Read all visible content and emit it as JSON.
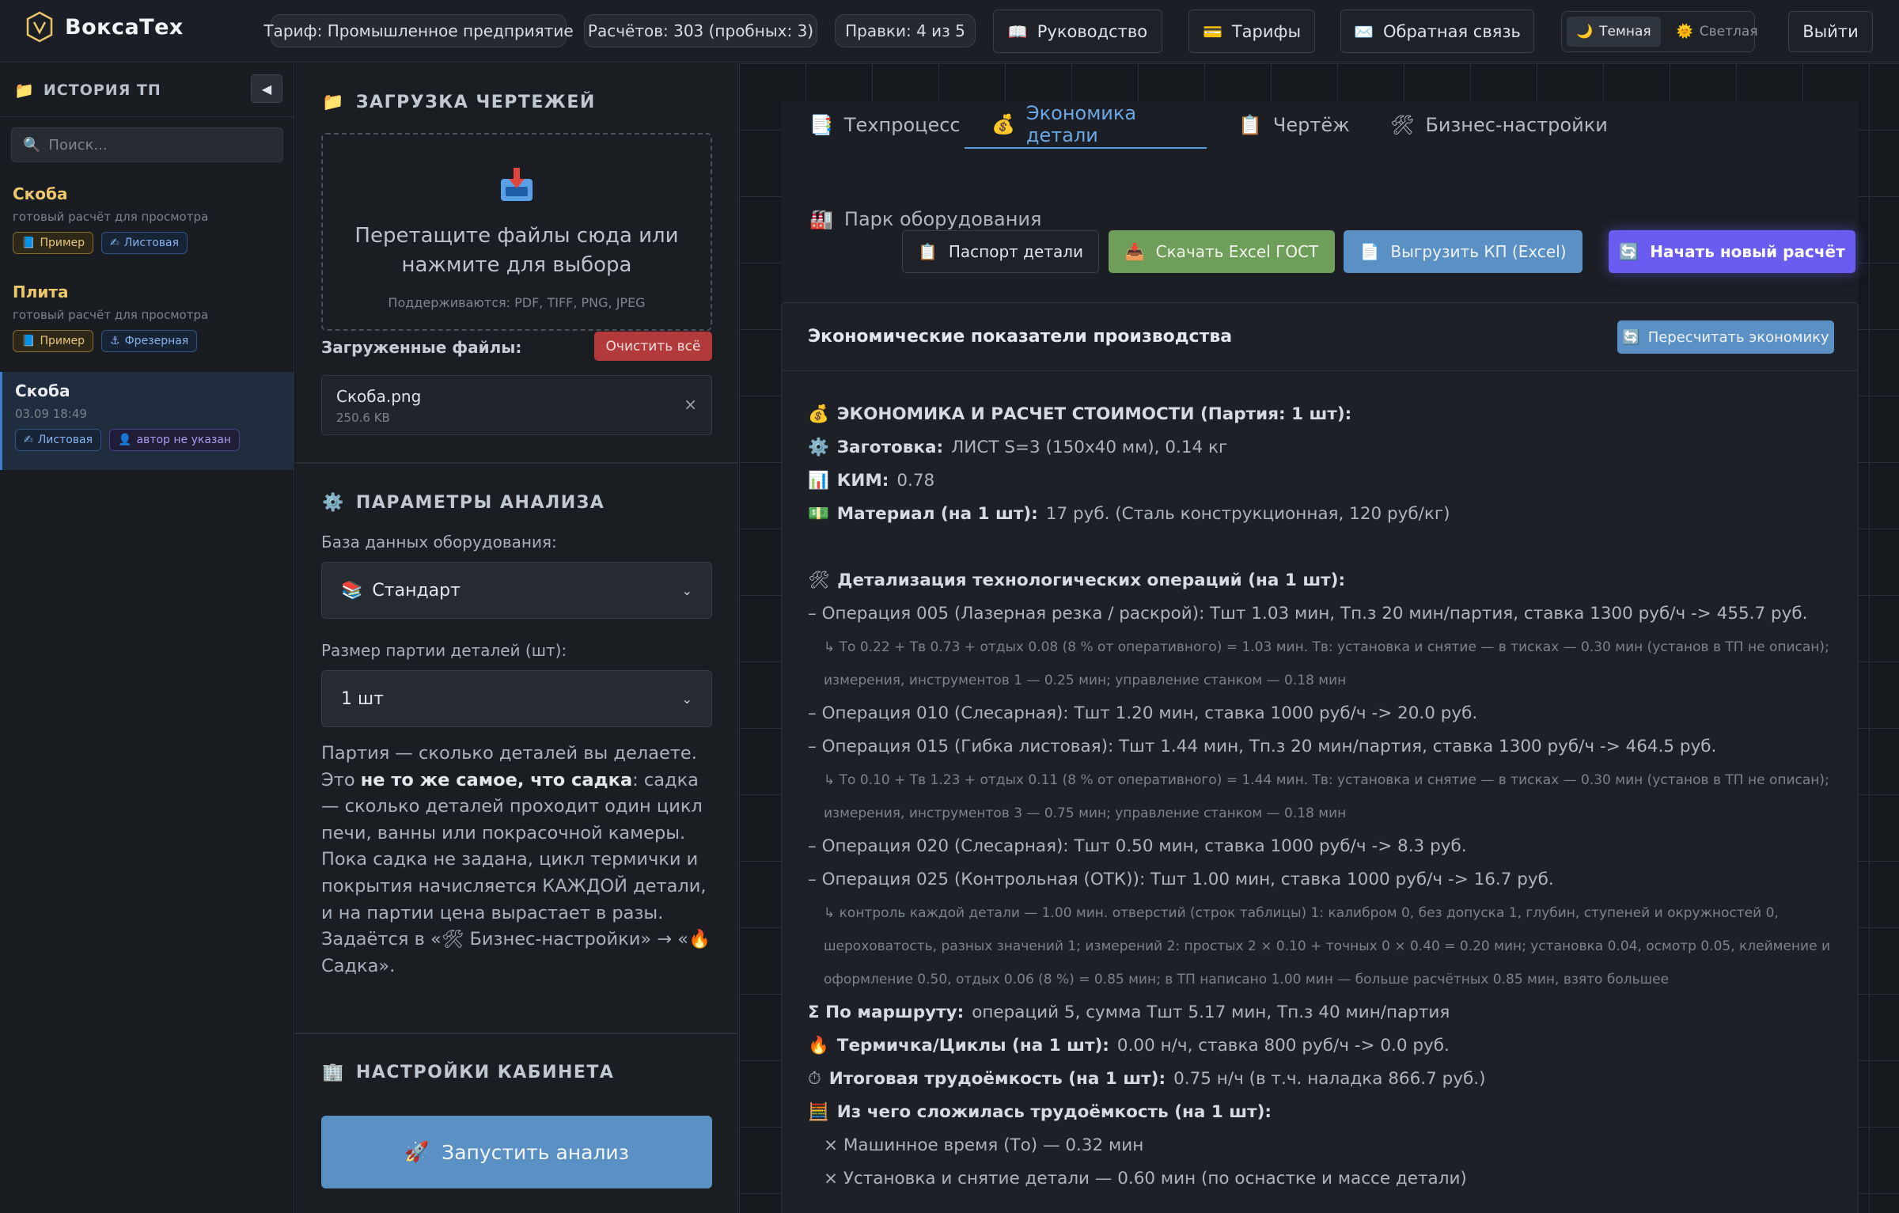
{
  "app": {
    "name": "ВоксаТех"
  },
  "topbar": {
    "tariff": "Тариф: Промышленное предприятие",
    "calcs": "Расчётов: 303 (пробных: 3)",
    "edits": "Правки: 4 из 5",
    "guide": "Руководство",
    "tariffs": "Тарифы",
    "feedback": "Обратная связь",
    "theme_dark": "Темная",
    "theme_light": "Светлая",
    "logout": "Выйти"
  },
  "history": {
    "title": "ИСТОРИЯ ТП",
    "collapse": "◀",
    "search_placeholder": "Поиск...",
    "items": [
      {
        "name": "Скоба",
        "sub": "готовый расчёт для просмотра",
        "tag1": "Пример",
        "tag2": "Листовая"
      },
      {
        "name": "Плита",
        "sub": "готовый расчёт для просмотра",
        "tag1": "Пример",
        "tag2": "Фрезерная"
      },
      {
        "name": "Скоба",
        "sub": "03.09 18:49",
        "tag1": "Листовая",
        "tag2": "автор не указан"
      }
    ]
  },
  "upload": {
    "title": "ЗАГРУЗКА ЧЕРТЕЖЕЙ",
    "drop_line1": "Перетащите файлы сюда или",
    "drop_line2": "нажмите для выбора",
    "supported": "Поддерживаются: PDF, TIFF, PNG, JPEG",
    "files_label": "Загруженные файлы:",
    "clear": "Очистить всё",
    "file_name": "Скоба.png",
    "file_size": "250.6 KB",
    "remove": "×"
  },
  "params": {
    "title": "ПАРАМЕТРЫ АНАЛИЗА",
    "db_label": "База данных оборудования:",
    "db_value": "Стандарт",
    "batch_label": "Размер партии деталей (шт):",
    "batch_value": "1 шт",
    "note_p1": "Партия — сколько деталей вы делаете. Это ",
    "note_bold": "не то же самое, что садка",
    "note_p2": ": садка — сколько деталей проходит один цикл печи, ванны или покрасочной камеры. Пока садка не задана, цикл термички и покрытия начисляется КАЖДОЙ детали, и на партии цена вырастает в разы. Задаётся в «🛠 Бизнес-настройки» → «🔥 Садка».",
    "cabinet_title": "НАСТРОЙКИ КАБИНЕТА",
    "run": "Запустить анализ"
  },
  "tabs": [
    {
      "label": "Техпроцесс"
    },
    {
      "label": "Экономика детали"
    },
    {
      "label": "Чертёж"
    },
    {
      "label": "Бизнес-настройки"
    }
  ],
  "park": "Парк оборудования",
  "actions": {
    "passport": "Паспорт детали",
    "excel_gost": "Скачать Excel ГОСТ",
    "kp": "Выгрузить КП (Excel)",
    "new_calc": "Начать новый расчёт"
  },
  "economics": {
    "title": "Экономические показатели производства",
    "recalc": "Пересчитать экономику",
    "h1": "ЭКОНОМИКА И РАСЧЕТ СТОИМОСТИ (Партия: 1 шт):",
    "blank_label": "Заготовка:",
    "blank_value": "ЛИСТ S=3 (150x40 мм), 0.14 кг",
    "kim_label": "КИМ:",
    "kim_value": "0.78",
    "material_label": "Материал (на 1 шт):",
    "material_value": "17 руб. (Сталь конструкционная, 120 руб/кг)",
    "ops_title": "Детализация технологических операций (на 1 шт):",
    "op005": "– Операция 005 (Лазерная резка / раскрой): Тшт 1.03 мин, Тп.з 20 мин/партия, ставка 1300 руб/ч -> 455.7 руб.",
    "op005_detail": "↳ То 0.22 + Тв 0.73 + отдых 0.08 (8 % от оперативного) = 1.03 мин. Тв: установка и снятие — в тисках — 0.30 мин (установ в ТП не описан); измерения, инструментов 1 — 0.25 мин; управление станком — 0.18 мин",
    "op010": "– Операция 010 (Слесарная): Тшт 1.20 мин, ставка 1000 руб/ч -> 20.0 руб.",
    "op015": "– Операция 015 (Гибка листовая): Тшт 1.44 мин, Тп.з 20 мин/партия, ставка 1300 руб/ч -> 464.5 руб.",
    "op015_detail": "↳ То 0.10 + Тв 1.23 + отдых 0.11 (8 % от оперативного) = 1.44 мин. Тв: установка и снятие — в тисках — 0.30 мин (установ в ТП не описан); измерения, инструментов 3 — 0.75 мин; управление станком — 0.18 мин",
    "op020": "– Операция 020 (Слесарная): Тшт 0.50 мин, ставка 1000 руб/ч -> 8.3 руб.",
    "op025": "– Операция 025 (Контрольная (ОТК)): Тшт 1.00 мин, ставка 1000 руб/ч -> 16.7 руб.",
    "op025_detail": "↳ контроль каждой детали — 1.00 мин. отверстий (строк таблицы) 1: калибром 0, без допуска 1, глубин, ступеней и окружностей 0, шероховатость, разных значений 1; измерений 2: простых 2 × 0.10 + точных 0 × 0.40 = 0.20 мин; установка 0.04, осмотр 0.05, клеймение и оформление 0.50, отдых 0.06 (8 %) = 0.85 мин; в ТП написано 1.00 мин — больше расчётных 0.85 мин, взято большее",
    "route_label": "Σ По маршруту:",
    "route_value": "операций 5, сумма Тшт 5.17 мин, Тп.з 40 мин/партия",
    "thermo_label": "Термичка/Циклы (на 1 шт):",
    "thermo_value": "0.00 н/ч, ставка 800 руб/ч -> 0.0 руб.",
    "labor_label": "Итоговая трудоёмкость (на 1 шт):",
    "labor_value": "0.75 н/ч (в т.ч. наладка 866.7 руб.)",
    "compose_label": "Из чего сложилась трудоёмкость (на 1 шт):",
    "c1": "× Машинное время (То) — 0.32 мин",
    "c2": "× Установка и снятие детали — 0.60 мин (по оснастке и массе детали)"
  }
}
